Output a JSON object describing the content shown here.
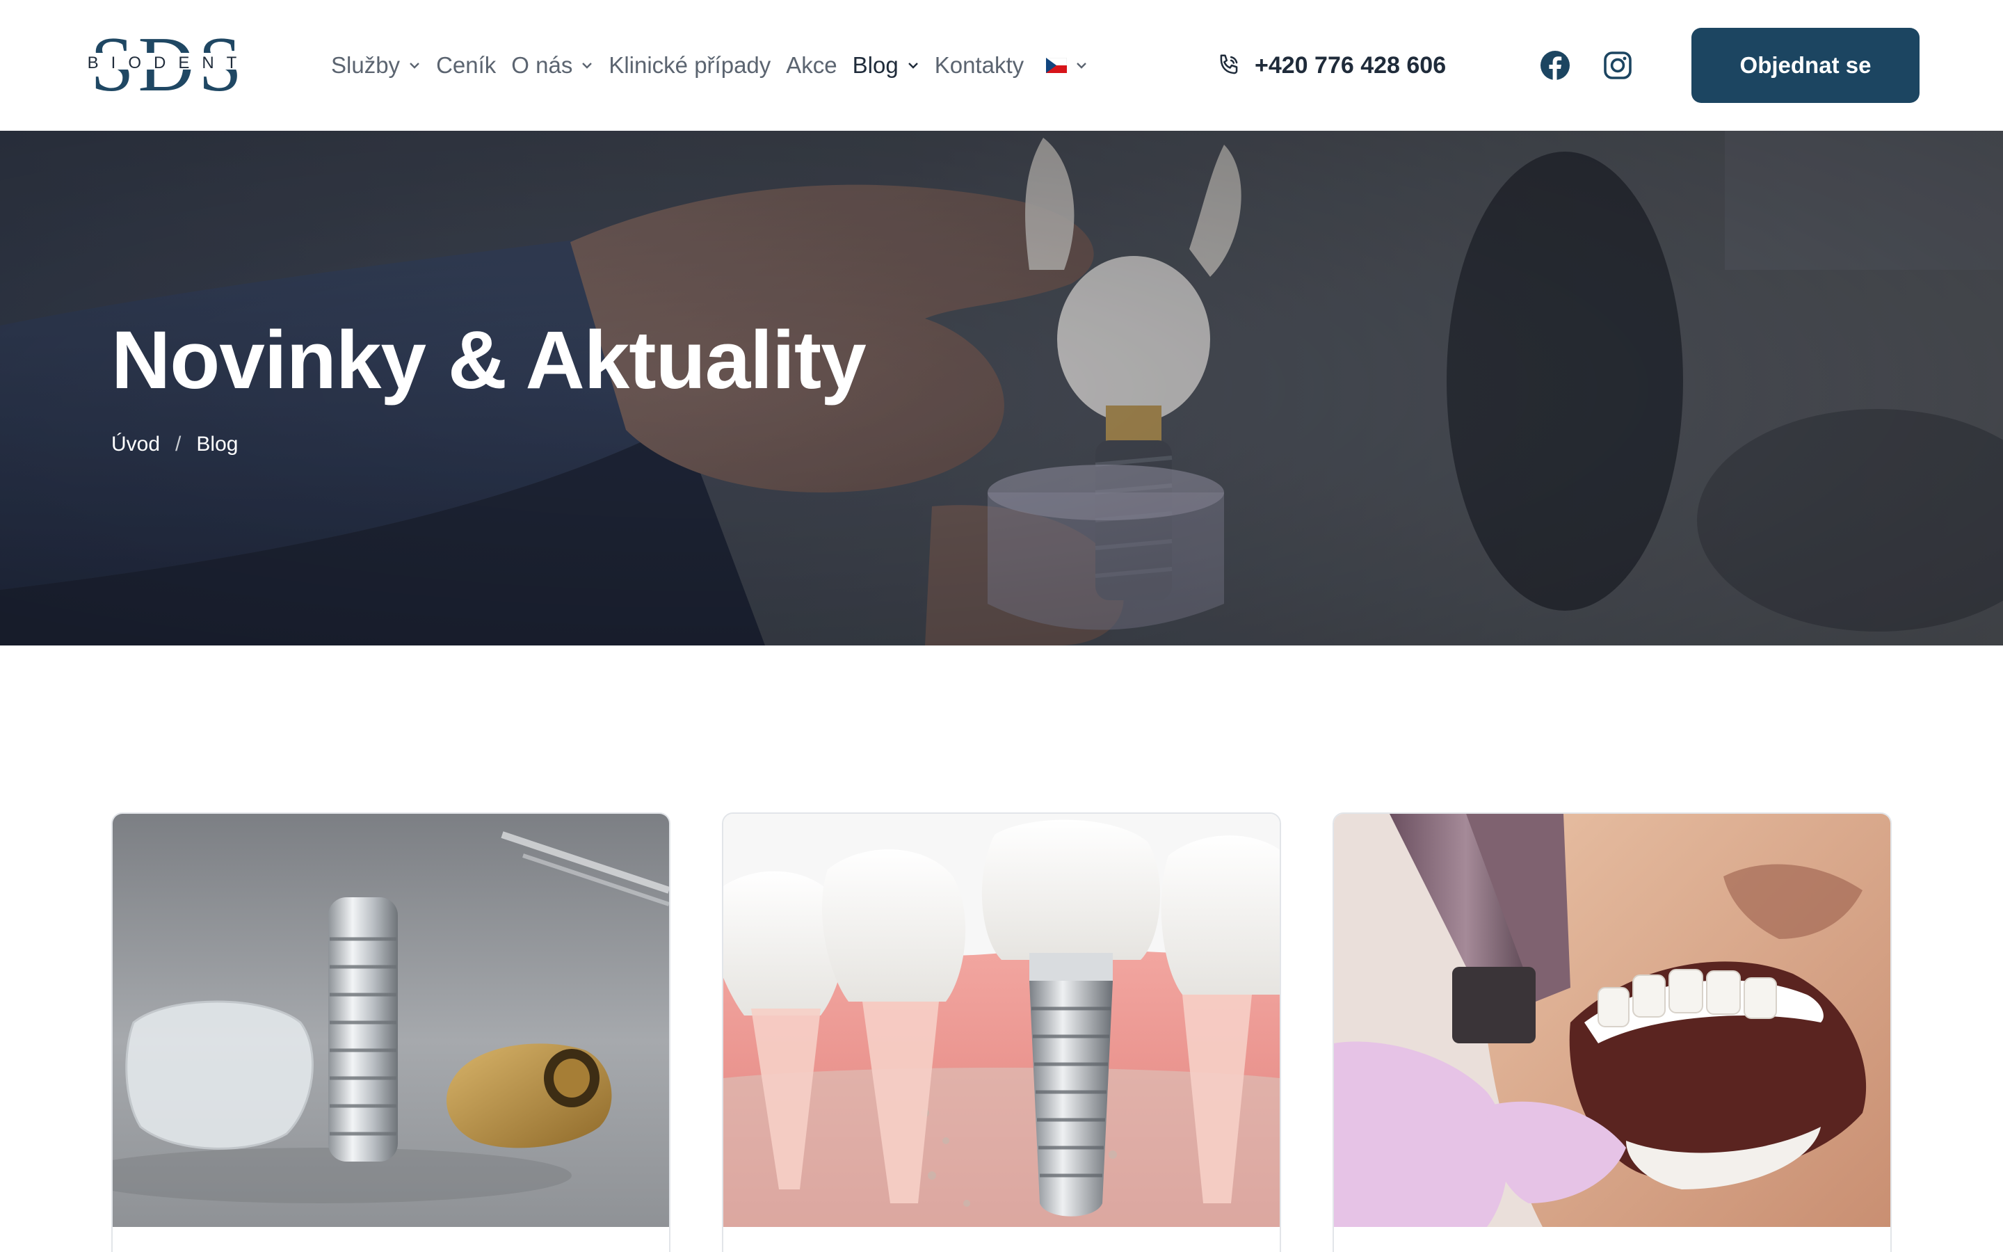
{
  "brand": {
    "logo_letters": "SDS",
    "logo_word": "BIODENT"
  },
  "nav": {
    "items": [
      {
        "label": "Služby",
        "has_dropdown": true
      },
      {
        "label": "Ceník",
        "has_dropdown": false
      },
      {
        "label": "O nás",
        "has_dropdown": true
      },
      {
        "label": "Klinické případy",
        "has_dropdown": false
      },
      {
        "label": "Akce",
        "has_dropdown": false
      },
      {
        "label": "Blog",
        "has_dropdown": true,
        "active": true
      },
      {
        "label": "Kontakty",
        "has_dropdown": false
      }
    ],
    "language_icon": "czech-flag-icon"
  },
  "contact": {
    "phone": "+420 776 428 606",
    "phone_icon": "phone-icon"
  },
  "social": {
    "icons": [
      "facebook-icon",
      "instagram-icon"
    ]
  },
  "cta": {
    "label": "Objednat se"
  },
  "hero": {
    "title": "Novinky & Aktuality",
    "breadcrumb": {
      "home": "Úvod",
      "separator": "/",
      "current": "Blog"
    }
  },
  "cards": [
    {
      "image": "dental-implant-components-photo"
    },
    {
      "image": "implant-in-jaw-illustration"
    },
    {
      "image": "tooth-extraction-photo"
    }
  ],
  "colors": {
    "primary": "#1c4561",
    "nav_text": "#5b6470",
    "nav_active": "#1f2b3a",
    "border": "#e2e5e9"
  }
}
